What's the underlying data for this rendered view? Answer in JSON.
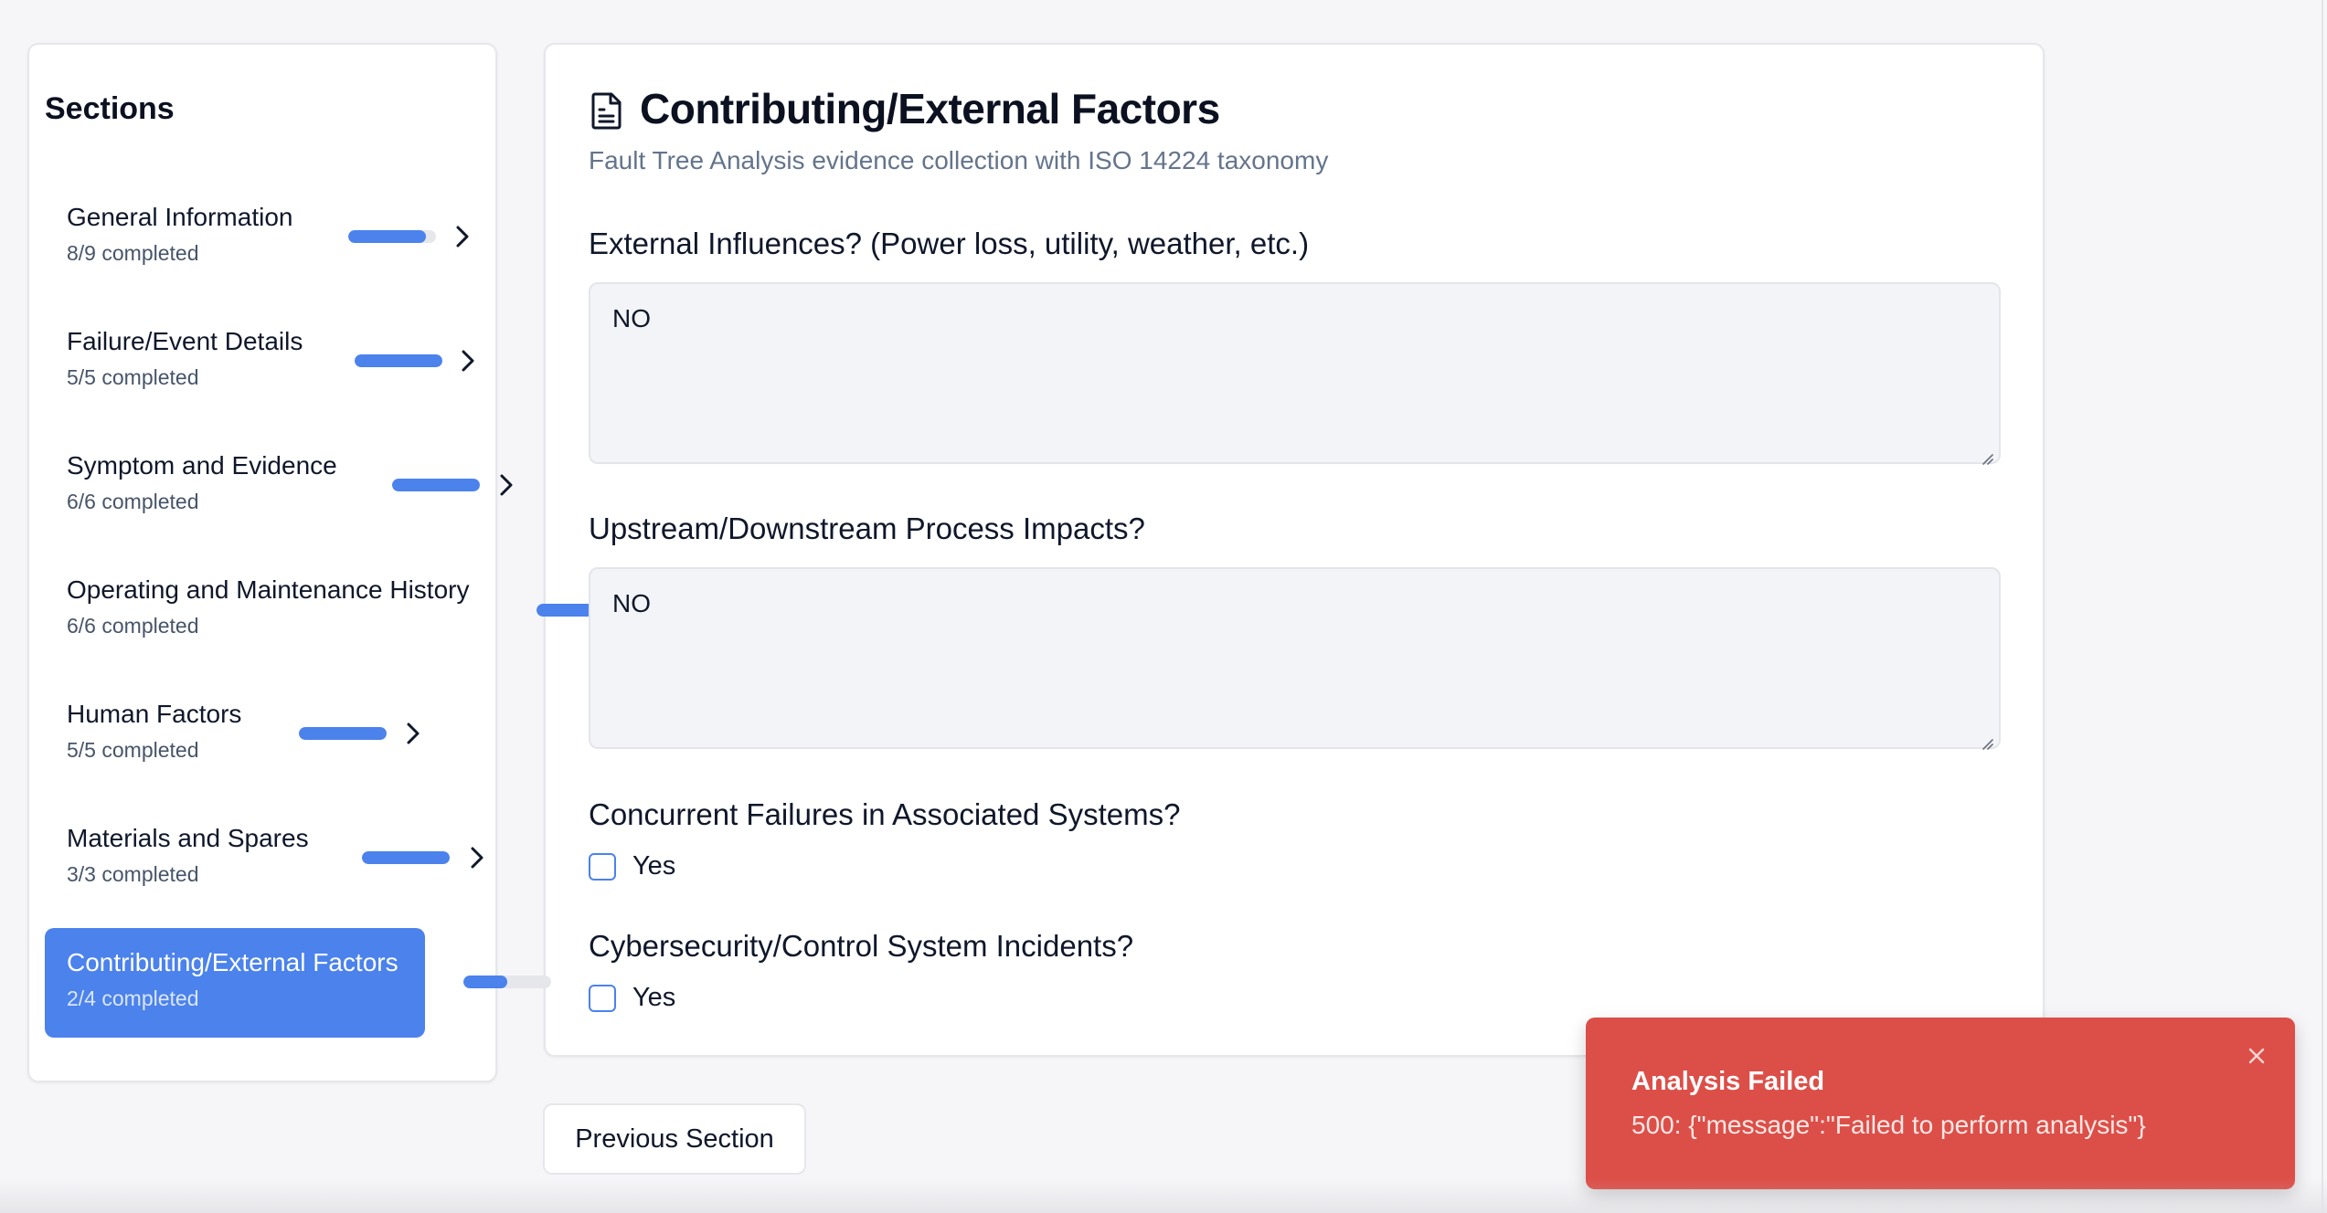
{
  "sidebar": {
    "title": "Sections",
    "items": [
      {
        "label": "General Information",
        "count": "8/9 completed",
        "progress": 0.89,
        "active": false
      },
      {
        "label": "Failure/Event Details",
        "count": "5/5 completed",
        "progress": 1.0,
        "active": false
      },
      {
        "label": "Symptom and Evidence",
        "count": "6/6 completed",
        "progress": 1.0,
        "active": false
      },
      {
        "label": "Operating and Maintenance History",
        "count": "6/6 completed",
        "progress": 1.0,
        "active": false
      },
      {
        "label": "Human Factors",
        "count": "5/5 completed",
        "progress": 1.0,
        "active": false
      },
      {
        "label": "Materials and Spares",
        "count": "3/3 completed",
        "progress": 1.0,
        "active": false
      },
      {
        "label": "Contributing/External Factors",
        "count": "2/4 completed",
        "progress": 0.5,
        "active": true
      }
    ]
  },
  "main": {
    "icon": "document-icon",
    "title": "Contributing/External Factors",
    "subtitle": "Fault Tree Analysis evidence collection with ISO 14224 taxonomy",
    "questions": [
      {
        "label": "External Influences? (Power loss, utility, weather, etc.)",
        "type": "textarea",
        "value": "NO"
      },
      {
        "label": "Upstream/Downstream Process Impacts?",
        "type": "textarea",
        "value": "NO"
      },
      {
        "label": "Concurrent Failures in Associated Systems?",
        "type": "checkbox",
        "option": "Yes",
        "checked": false
      },
      {
        "label": "Cybersecurity/Control System Incidents?",
        "type": "checkbox",
        "option": "Yes",
        "checked": false
      }
    ]
  },
  "footer": {
    "previous_label": "Previous Section"
  },
  "toast": {
    "title": "Analysis Failed",
    "message": "500: {\"message\":\"Failed to perform analysis\"}"
  },
  "colors": {
    "accent": "#4b82ec",
    "error": "#dc4f48"
  }
}
